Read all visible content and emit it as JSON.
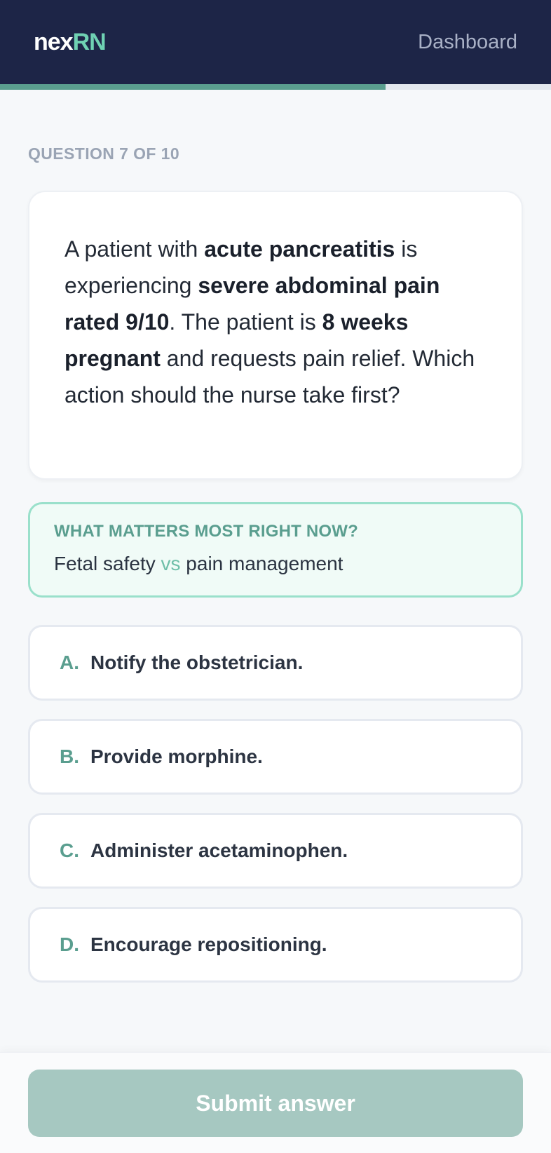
{
  "header": {
    "logo_part1": "nex",
    "logo_part2": "RN",
    "dashboard_label": "Dashboard",
    "progress_fraction": 0.7
  },
  "quiz": {
    "counter": "QUESTION 7 OF 10",
    "question": {
      "t1": "A patient with ",
      "b1": "acute pancreatitis",
      "t2": " is experiencing ",
      "b2": "severe abdominal pain rated 9/10",
      "t3": ". The patient is ",
      "b3": "8 weeks pregnant",
      "t4": " and requests pain relief. Which action should the nurse take first?"
    },
    "focus": {
      "title": "WHAT MATTERS MOST RIGHT NOW?",
      "left": "Fetal safety",
      "vs": "vs",
      "right": "pain management"
    },
    "options": [
      {
        "letter": "A.",
        "text": "Notify the obstetrician."
      },
      {
        "letter": "B.",
        "text": "Provide morphine."
      },
      {
        "letter": "C.",
        "text": "Administer acetaminophen."
      },
      {
        "letter": "D.",
        "text": "Encourage repositioning."
      }
    ],
    "submit_label": "Submit answer"
  },
  "colors": {
    "header_bg": "#1d2547",
    "accent": "#5a9e8f",
    "logo_accent": "#6fd1b3",
    "submit_disabled": "#a6c8c1"
  }
}
